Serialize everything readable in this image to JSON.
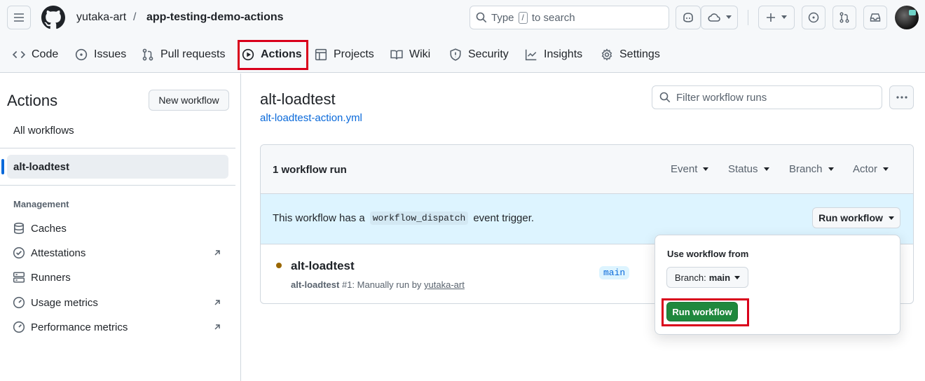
{
  "header": {
    "owner": "yutaka-art",
    "separator": "/",
    "repo": "app-testing-demo-actions",
    "search_prefix": "Type",
    "search_key": "/",
    "search_suffix": "to search"
  },
  "tabs": [
    "Code",
    "Issues",
    "Pull requests",
    "Actions",
    "Projects",
    "Wiki",
    "Security",
    "Insights",
    "Settings"
  ],
  "sidebar": {
    "title": "Actions",
    "new_workflow": "New workflow",
    "all_workflows": "All workflows",
    "selected_workflow": "alt-loadtest",
    "management_heading": "Management",
    "management_items": [
      "Caches",
      "Attestations",
      "Runners",
      "Usage metrics",
      "Performance metrics"
    ]
  },
  "main": {
    "title": "alt-loadtest",
    "file_link": "alt-loadtest-action.yml",
    "filter_placeholder": "Filter workflow runs",
    "runs_count": "1 workflow run",
    "filters": [
      "Event",
      "Status",
      "Branch",
      "Actor"
    ],
    "dispatch_prefix": "This workflow has a",
    "dispatch_code": "workflow_dispatch",
    "dispatch_suffix": "event trigger.",
    "run_workflow_button": "Run workflow",
    "run": {
      "name": "alt-loadtest",
      "meta_workflow": "alt-loadtest",
      "meta_number": "#1: Manually run by",
      "meta_user": "yutaka-art",
      "branch": "main",
      "status_color": "#9a6700"
    }
  },
  "popover": {
    "heading": "Use workflow from",
    "branch_label": "Branch:",
    "branch_value": "main",
    "run_button": "Run workflow"
  },
  "colors": {
    "accent": "#0969da",
    "success": "#1f883d",
    "highlight": "#d9001b",
    "banner": "#ddf4ff"
  }
}
